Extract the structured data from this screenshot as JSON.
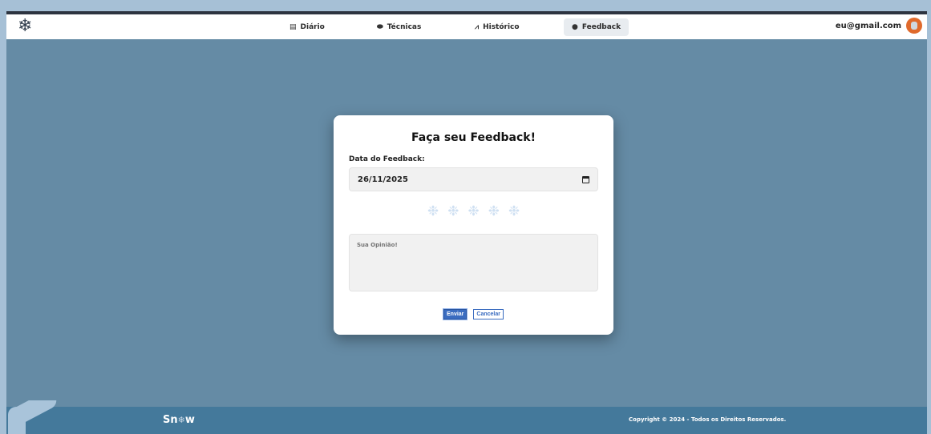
{
  "app": {
    "logo_glyph": "❄"
  },
  "nav": {
    "items": [
      {
        "label": "Diário",
        "icon": "book-icon",
        "glyph": "▤"
      },
      {
        "label": "Técnicas",
        "icon": "bandage-icon",
        "glyph": "⬬"
      },
      {
        "label": "Histórico",
        "icon": "chart-line-icon",
        "glyph": "⩘"
      },
      {
        "label": "Feedback",
        "icon": "comments-icon",
        "glyph": "●"
      }
    ],
    "active": "Feedback"
  },
  "user": {
    "email": "eu@gmail.com"
  },
  "form": {
    "title": "Faça seu Feedback!",
    "date_label": "Data do Feedback:",
    "date_value": "26/11/2025",
    "rating_glyph": "❉",
    "rating_max": 5,
    "rating_value": 0,
    "opinion_placeholder": "Sua Opinião!",
    "send_label": "Enviar",
    "cancel_label": "Cancelar"
  },
  "footer": {
    "brand_left": "Sn",
    "brand_flake": "❄",
    "brand_right": "w",
    "copyright": "Copyright © 2024 - Todos os Direitos Reservados."
  },
  "colors": {
    "accent": "#3a6cc0",
    "background": "#658ba5",
    "footer": "#44799b"
  }
}
